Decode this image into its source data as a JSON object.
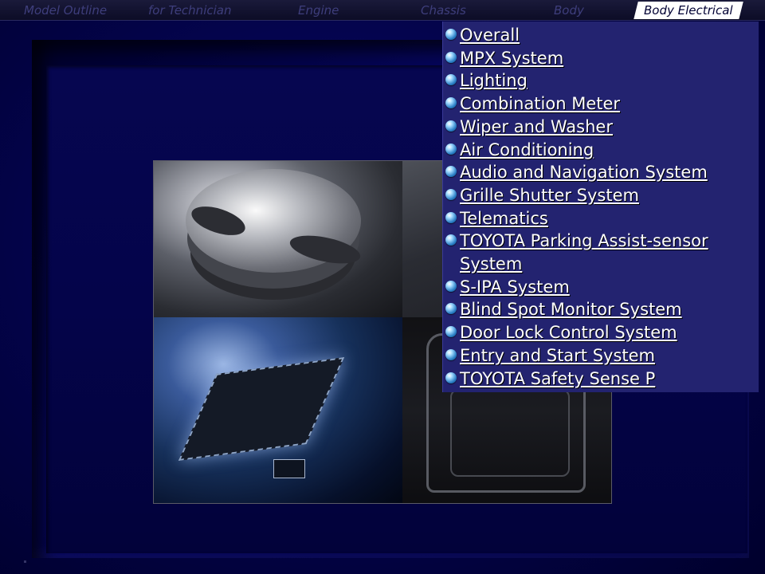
{
  "nav": {
    "tabs": [
      {
        "label": "Model Outline",
        "active": false
      },
      {
        "label": "for Technician",
        "active": false
      },
      {
        "label": "Engine",
        "active": false
      },
      {
        "label": "Chassis",
        "active": false
      },
      {
        "label": "Body",
        "active": false
      },
      {
        "label": "Body Electrical",
        "active": true
      }
    ]
  },
  "menu": {
    "items": [
      "Overall",
      "MPX System",
      "Lighting",
      "Combination Meter",
      "Wiper and Washer",
      "Air Conditioning",
      "Audio and Navigation System",
      "Grille Shutter System",
      "Telematics",
      "TOYOTA Parking Assist-sensor System",
      "S-IPA System",
      "Blind Spot Monitor System",
      "Door Lock Control System",
      "Entry and Start System",
      "TOYOTA Safety Sense P"
    ]
  },
  "colors": {
    "background": "#00003a",
    "menu_background": "#232370",
    "tab_inactive_text": "#3e3e7c",
    "tab_active_background": "#ffffff",
    "menu_text": "#ffffff",
    "bullet": "#2a7fc6"
  },
  "icons": {
    "menu_bullet": "blue-sphere-bullet-icon"
  }
}
